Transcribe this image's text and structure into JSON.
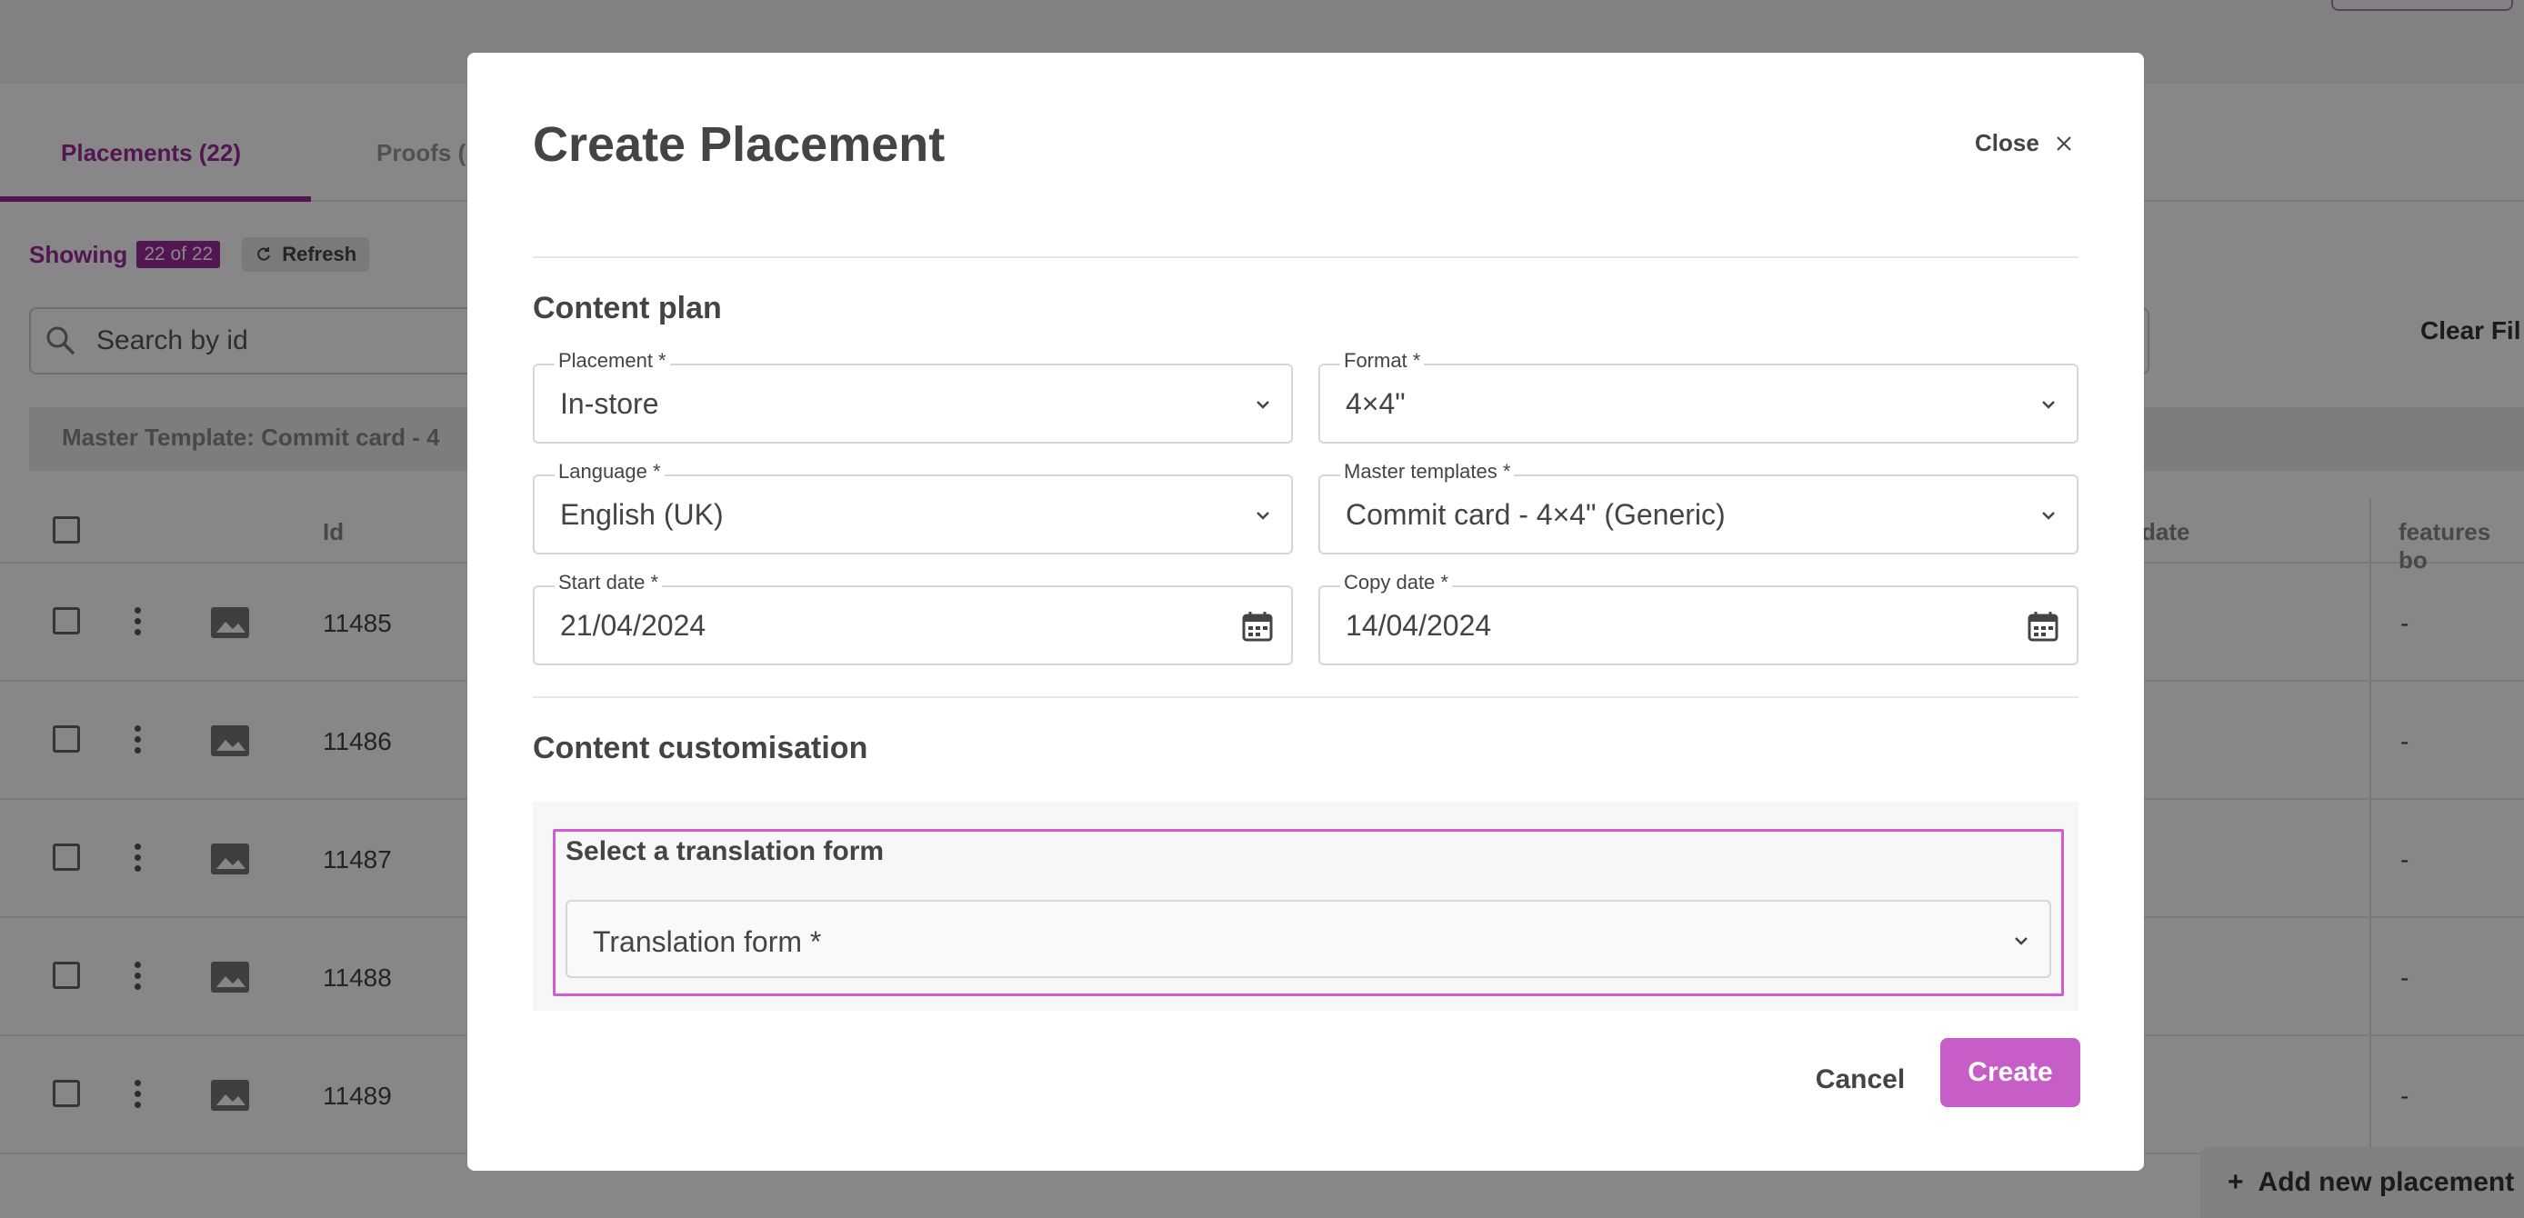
{
  "background": {
    "tabs": [
      {
        "label": "Placements (22)",
        "active": true
      },
      {
        "label": "Proofs (",
        "active": false
      }
    ],
    "showing": {
      "label": "Showing",
      "badge": "22 of 22"
    },
    "refresh_label": "Refresh",
    "search": {
      "placeholder": "Search by id"
    },
    "clear_filters": "Clear Fil",
    "filter_chip": "Master Template: Commit card - 4",
    "table": {
      "columns": {
        "id": "Id",
        "date": "date",
        "features": "features bo"
      },
      "rows": [
        {
          "id": "11485",
          "last": "-"
        },
        {
          "id": "11486",
          "last": "-"
        },
        {
          "id": "11487",
          "last": "-"
        },
        {
          "id": "11488",
          "last": "-"
        },
        {
          "id": "11489",
          "last": "-"
        }
      ]
    },
    "add_placement": {
      "icon": "plus",
      "label": "Add new placement"
    }
  },
  "modal": {
    "title": "Create Placement",
    "close_label": "Close",
    "content_plan": {
      "title": "Content plan",
      "placement": {
        "label": "Placement *",
        "value": "In-store"
      },
      "format": {
        "label": "Format *",
        "value": "4×4\""
      },
      "language": {
        "label": "Language *",
        "value": "English (UK)"
      },
      "master_template": {
        "label": "Master templates *",
        "value": "Commit card - 4×4\" (Generic)"
      },
      "start_date": {
        "label": "Start date *",
        "value": "21/04/2024"
      },
      "copy_date": {
        "label": "Copy date *",
        "value": "14/04/2024"
      }
    },
    "customisation": {
      "title": "Content customisation",
      "translation_heading": "Select a translation form",
      "translation_field": "Translation form *"
    },
    "cancel_label": "Cancel",
    "create_label": "Create"
  },
  "colors": {
    "accent": "#9b2a9b",
    "create_button": "#c75ec7",
    "highlight_border": "#d15ed1"
  }
}
